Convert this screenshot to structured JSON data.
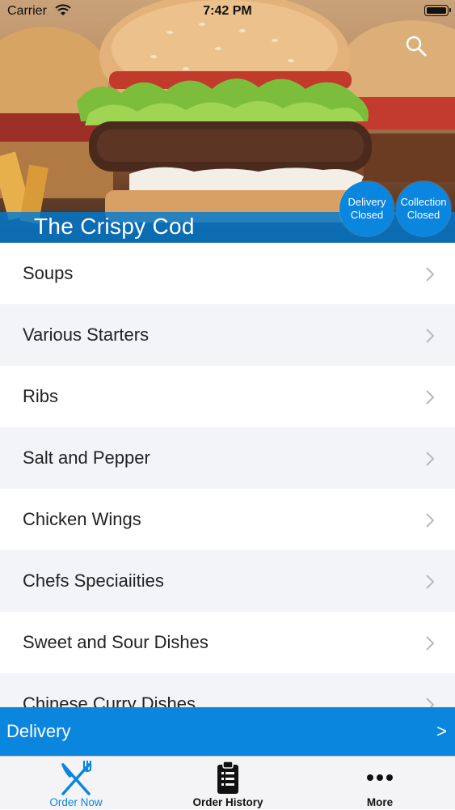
{
  "status_bar": {
    "carrier": "Carrier",
    "time": "7:42 PM"
  },
  "header": {
    "restaurant_name": "The Crispy Cod",
    "delivery_status": {
      "line1": "Delivery",
      "line2": "Closed"
    },
    "collection_status": {
      "line1": "Collection",
      "line2": "Closed"
    }
  },
  "menu": {
    "items": [
      {
        "label": "Soups"
      },
      {
        "label": "Various Starters"
      },
      {
        "label": "Ribs"
      },
      {
        "label": "Salt and Pepper"
      },
      {
        "label": "Chicken Wings"
      },
      {
        "label": "Chefs Speciaiities"
      },
      {
        "label": "Sweet and Sour Dishes"
      },
      {
        "label": "Chinese Curry Dishes"
      }
    ]
  },
  "delivery_bar": {
    "label": "Delivery",
    "arrow": ">"
  },
  "tab_bar": {
    "tabs": [
      {
        "label": "Order Now",
        "icon": "fork-knife-icon",
        "active": true
      },
      {
        "label": "Order History",
        "icon": "clipboard-list-icon",
        "active": false
      },
      {
        "label": "More",
        "icon": "more-dots-icon",
        "active": false
      }
    ]
  },
  "colors": {
    "accent": "#0a86df",
    "row_alt": "#f2f4f7"
  }
}
